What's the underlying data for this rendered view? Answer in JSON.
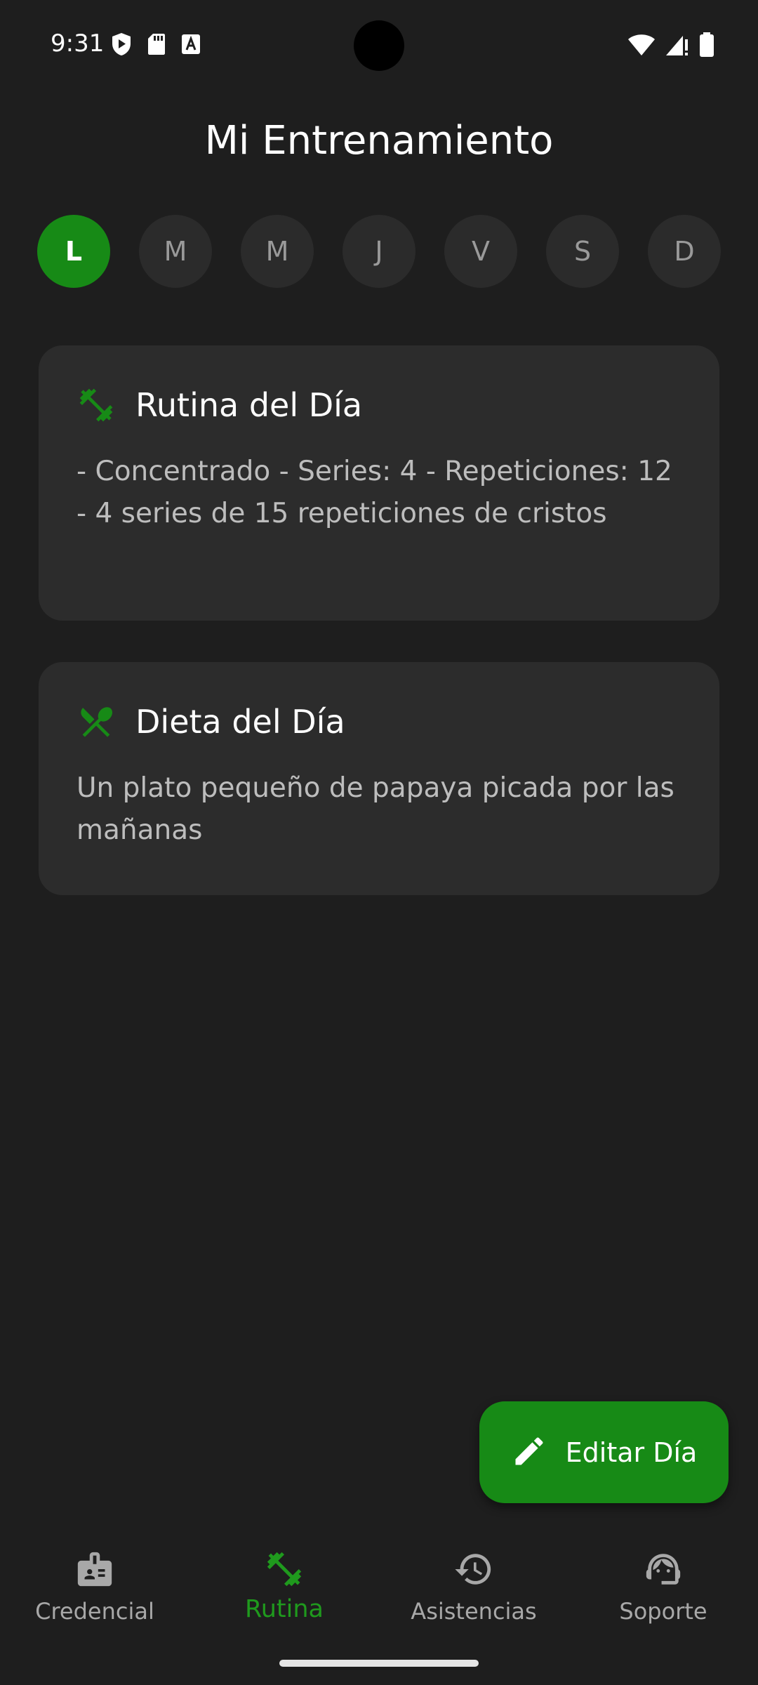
{
  "status_bar": {
    "time": "9:31"
  },
  "header": {
    "title": "Mi Entrenamiento"
  },
  "days": [
    {
      "label": "L",
      "active": true
    },
    {
      "label": "M",
      "active": false
    },
    {
      "label": "M",
      "active": false
    },
    {
      "label": "J",
      "active": false
    },
    {
      "label": "V",
      "active": false
    },
    {
      "label": "S",
      "active": false
    },
    {
      "label": "D",
      "active": false
    }
  ],
  "routine_card": {
    "icon": "dumbbell-icon",
    "title": "Rutina del Día",
    "body": "- Concentrado - Series: 4  - Repeticiones: 12\n- 4 series de 15 repeticiones de cristos"
  },
  "diet_card": {
    "icon": "restaurant-icon",
    "title": "Dieta del Día",
    "body": "Un plato pequeño de papaya picada por las mañanas"
  },
  "fab": {
    "icon": "pencil-icon",
    "label": "Editar Día"
  },
  "bottom_nav": {
    "items": [
      {
        "label": "Credencial",
        "icon": "badge-icon",
        "active": false
      },
      {
        "label": "Rutina",
        "icon": "dumbbell-icon",
        "active": true
      },
      {
        "label": "Asistencias",
        "icon": "history-icon",
        "active": false
      },
      {
        "label": "Soporte",
        "icon": "support-agent-icon",
        "active": false
      }
    ]
  },
  "colors": {
    "background": "#1e1e1e",
    "card": "#2c2c2c",
    "accent": "#178a16",
    "accent_text": "#1f9a1d",
    "inactive_day": "#2b2b2b",
    "muted_text": "#bdbdbd"
  }
}
